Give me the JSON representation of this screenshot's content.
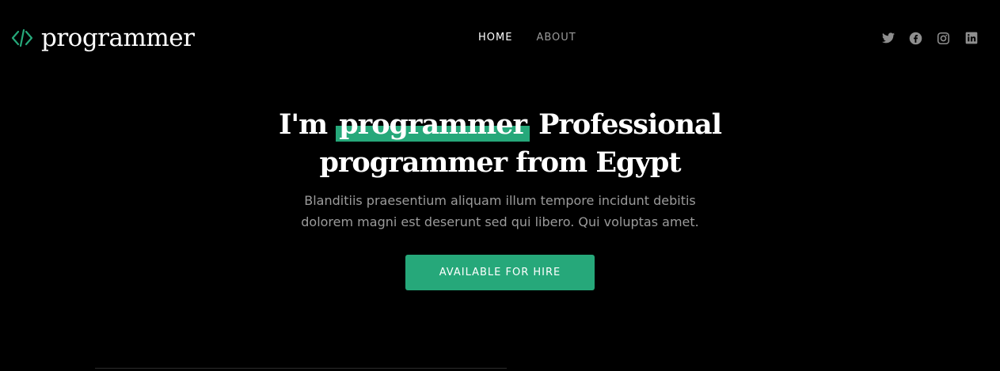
{
  "brand": {
    "name": "programmer",
    "icon": "code-icon",
    "accent_color": "#26a87a"
  },
  "nav": {
    "items": [
      {
        "label": "HOME",
        "active": true
      },
      {
        "label": "ABOUT",
        "active": false
      }
    ]
  },
  "socials": [
    {
      "icon": "twitter-icon"
    },
    {
      "icon": "facebook-icon"
    },
    {
      "icon": "instagram-icon"
    },
    {
      "icon": "linkedin-icon"
    }
  ],
  "hero": {
    "title_prefix": "I'm",
    "title_highlight": "programmer",
    "title_suffix": "Professional programmer from Egypt",
    "subtitle": "Blanditiis praesentium aliquam illum tempore incidunt debitis dolorem magni est deserunt sed qui libero. Qui voluptas amet.",
    "cta_label": "AVAILABLE FOR HIRE"
  },
  "colors": {
    "background": "#000000",
    "text": "#ffffff",
    "muted": "#9b9b9b",
    "accent": "#26a87a"
  }
}
